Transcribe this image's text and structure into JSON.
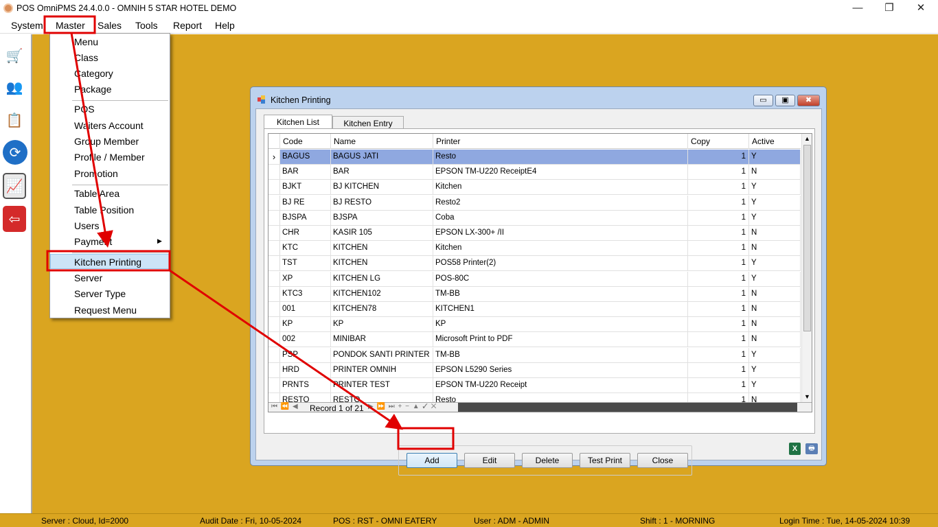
{
  "app": {
    "title": "POS OmniPMS 24.4.0.0 - OMNIH 5 STAR HOTEL DEMO",
    "minimize": "—",
    "restore": "❐",
    "close": "✕"
  },
  "menubar": {
    "items": [
      "System",
      "Master",
      "Sales",
      "Tools",
      "Report",
      "Help"
    ]
  },
  "toolbar": {
    "icons": [
      "shopping-cart-icon",
      "users-icon",
      "clipboard-icon",
      "refresh-icon",
      "chart-icon",
      "exit-icon"
    ]
  },
  "dropdown": {
    "items": [
      "Menu",
      "Class",
      "Category",
      "Package",
      "POS",
      "Waiters Account",
      "Group Member",
      "Profile / Member",
      "Promotion",
      "Table Area",
      "Table Position",
      "Users",
      "Payment",
      "Kitchen Printing",
      "Server",
      "Server Type",
      "Request Menu"
    ],
    "submenu_arrow": "▶"
  },
  "dialog": {
    "title": "Kitchen Printing",
    "btn_min": "▭",
    "btn_max": "▣",
    "btn_close": "✖",
    "tabs": [
      "Kitchen List",
      "Kitchen Entry"
    ],
    "columns": [
      "Code",
      "Name",
      "Printer",
      "Copy",
      "Active"
    ],
    "rows": [
      [
        "BAGUS",
        "BAGUS JATI",
        "Resto",
        "1",
        "Y"
      ],
      [
        "BAR",
        "BAR",
        "EPSON TM-U220 ReceiptE4",
        "1",
        "N"
      ],
      [
        "BJKT",
        "BJ KITCHEN",
        "Kitchen",
        "1",
        "Y"
      ],
      [
        "BJ RE",
        "BJ RESTO",
        "Resto2",
        "1",
        "Y"
      ],
      [
        "BJSPA",
        "BJSPA",
        "Coba",
        "1",
        "Y"
      ],
      [
        "CHR",
        "KASIR 105",
        "EPSON LX-300+ /II",
        "1",
        "N"
      ],
      [
        "KTC",
        "KITCHEN",
        "Kitchen",
        "1",
        "N"
      ],
      [
        "TST",
        "KITCHEN",
        "POS58 Printer(2)",
        "1",
        "Y"
      ],
      [
        "XP",
        "KITCHEN LG",
        "POS-80C",
        "1",
        "Y"
      ],
      [
        "KTC3",
        "KITCHEN102",
        "TM-BB",
        "1",
        "N"
      ],
      [
        "001",
        "KITCHEN78",
        "KITCHEN1",
        "1",
        "N"
      ],
      [
        "KP",
        "KP",
        "KP",
        "1",
        "N"
      ],
      [
        "002",
        "MINIBAR",
        "Microsoft Print to PDF",
        "1",
        "N"
      ],
      [
        "PSP",
        "PONDOK SANTI PRINTER",
        "TM-BB",
        "1",
        "Y"
      ],
      [
        "HRD",
        "PRINTER OMNIH",
        "EPSON L5290 Series",
        "1",
        "Y"
      ],
      [
        "PRNTS",
        "PRINTER TEST",
        "EPSON TM-U220 Receipt",
        "1",
        "Y"
      ],
      [
        "RESTO",
        "RESTO",
        "Resto",
        "1",
        "N"
      ]
    ],
    "selected_row_marker": "›",
    "nav_left": "⏮ ⏪ ◀",
    "record_label": "Record 1 of 21",
    "nav_right": "▶ ⏩ ⏭ + − ▲ ✓ ✕",
    "buttons": [
      "Add",
      "Edit",
      "Delete",
      "Test Print",
      "Close"
    ],
    "excel_glyph": "X",
    "printer_glyph": "🖶"
  },
  "status": {
    "server": "Server : Cloud, Id=2000",
    "audit": "Audit Date : Fri, 10-05-2024",
    "pos": "POS : RST - OMNI EATERY",
    "user": "User : ADM - ADMIN",
    "shift": "Shift : 1 - MORNING",
    "login": "Login Time : Tue, 14-05-2024 10:39"
  },
  "colors": {
    "workspace": "#daa520",
    "highlight": "#e00000",
    "selected_row": "#8fa8e0"
  }
}
